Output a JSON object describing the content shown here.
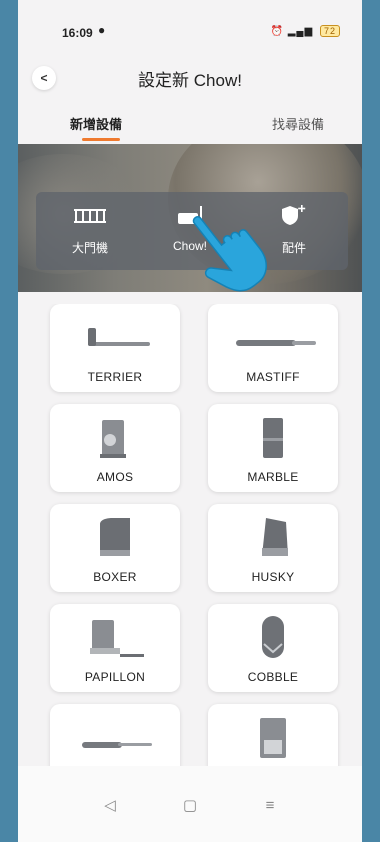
{
  "status_bar": {
    "time": "16:09",
    "battery": "72"
  },
  "header": {
    "back_label": "<",
    "title": "設定新 Chow!"
  },
  "tabs": [
    {
      "label": "新增設備"
    },
    {
      "label": "找尋設備"
    }
  ],
  "overlay": {
    "items": [
      {
        "label": "大門機"
      },
      {
        "label": "Chow!"
      },
      {
        "label": "配件"
      }
    ]
  },
  "devices": [
    {
      "label": "TERRIER",
      "icon": "bar-actuator-icon"
    },
    {
      "label": "MASTIFF",
      "icon": "slim-actuator-icon"
    },
    {
      "label": "AMOS",
      "icon": "motor-box-icon"
    },
    {
      "label": "MARBLE",
      "icon": "cabinet-icon"
    },
    {
      "label": "BOXER",
      "icon": "sliding-motor-icon"
    },
    {
      "label": "HUSKY",
      "icon": "angled-motor-icon"
    },
    {
      "label": "PAPILLON",
      "icon": "underground-motor-icon"
    },
    {
      "label": "COBBLE",
      "icon": "rounded-housing-icon"
    },
    {
      "label": "",
      "icon": "pen-actuator-icon"
    },
    {
      "label": "",
      "icon": "control-box-icon"
    }
  ],
  "navbar": {
    "back": "◁",
    "home": "▢",
    "menu": "≡"
  },
  "colors": {
    "accent": "#ef7a2f",
    "hand": "#2aa5dc",
    "background": "#f4f3f4"
  }
}
